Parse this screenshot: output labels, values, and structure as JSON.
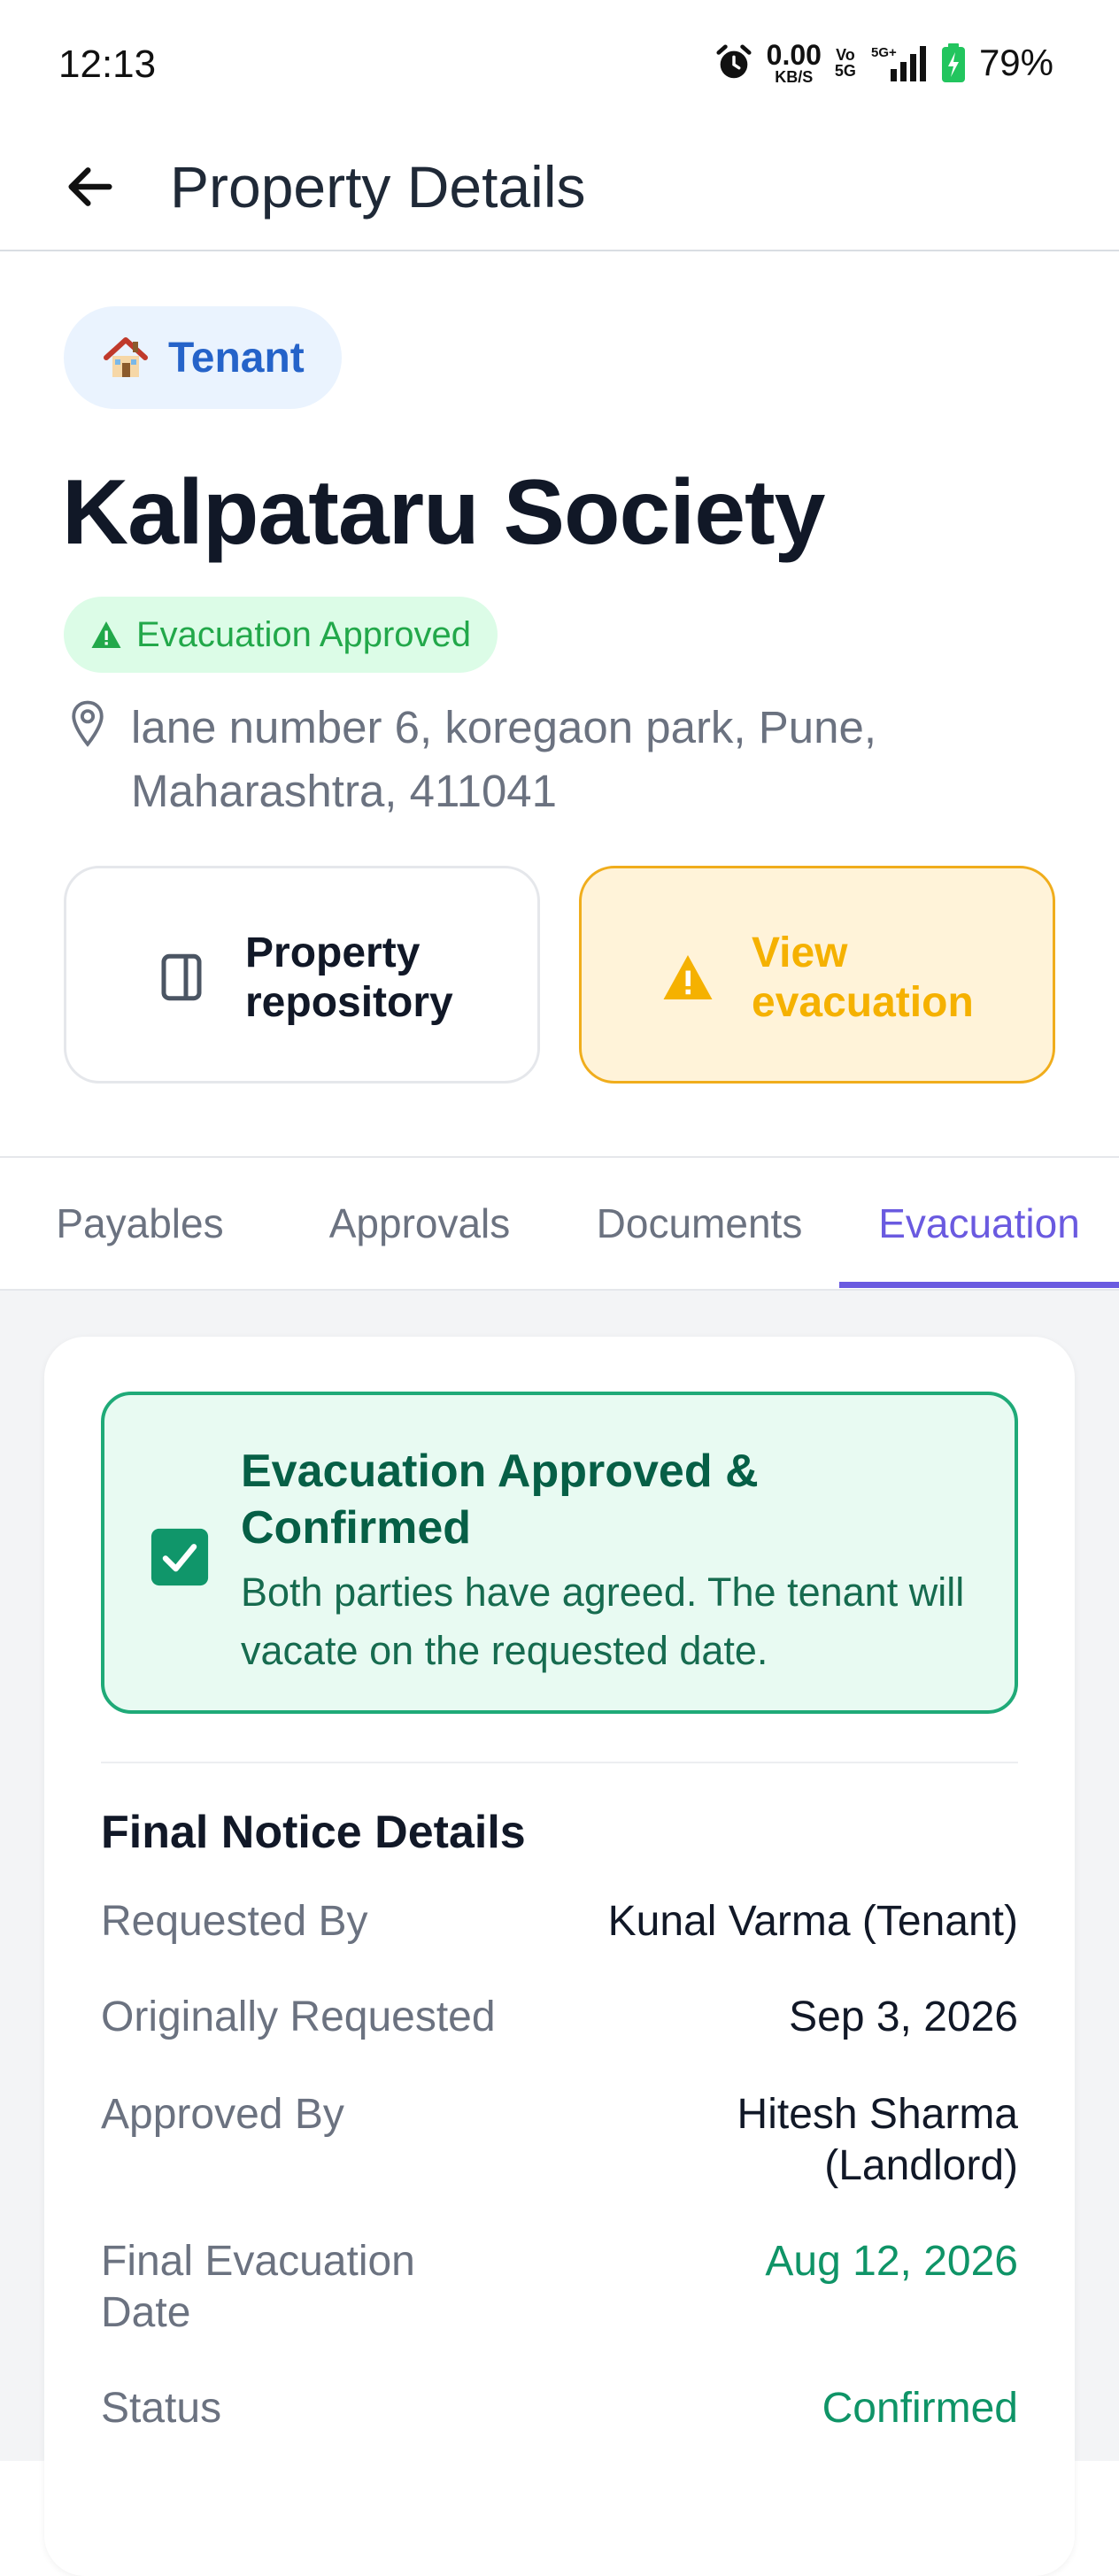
{
  "status_bar": {
    "time": "12:13",
    "net_speed_value": "0.00",
    "net_speed_unit": "KB/S",
    "volte_top": "Vo",
    "volte_bottom": "5G",
    "network_label": "5G+",
    "battery_percent": "79%",
    "icons": [
      "alarm-icon",
      "signal-icon",
      "battery-charging-icon"
    ]
  },
  "app_bar": {
    "title": "Property Details",
    "back_icon": "arrow-left-icon"
  },
  "property": {
    "role_icon": "house-icon",
    "role": "Tenant",
    "name": "Kalpataru Society",
    "status": "Evacuation Approved",
    "address_line1": "lane number 6, koregaon park, Pune,",
    "address_line2": "Maharashtra, 411041"
  },
  "actions": {
    "repository_line1": "Property",
    "repository_line2": "repository",
    "evacuation_line1": "View",
    "evacuation_line2": "evacuation"
  },
  "tabs": [
    {
      "label": "Payables",
      "active": false
    },
    {
      "label": "Approvals",
      "active": false
    },
    {
      "label": "Documents",
      "active": false
    },
    {
      "label": "Evacuation",
      "active": true
    }
  ],
  "evacuation": {
    "confirm_title_line1": "Evacuation Approved &",
    "confirm_title_line2": "Confirmed",
    "confirm_desc_line1": "Both parties have agreed. The tenant will",
    "confirm_desc_line2": "vacate on the requested date.",
    "notice_title": "Final Notice Details",
    "details": {
      "requested_by_label": "Requested By",
      "requested_by_value": "Kunal Varma (Tenant)",
      "originally_requested_label": "Originally Requested",
      "originally_requested_value": "Sep 3, 2026",
      "approved_by_label": "Approved By",
      "approved_by_value_line1": "Hitesh Sharma",
      "approved_by_value_line2": "(Landlord)",
      "final_date_label_line1": "Final Evacuation",
      "final_date_label_line2": "Date",
      "final_date_value": "Aug 12, 2026",
      "status_label": "Status",
      "status_value": "Confirmed"
    }
  },
  "colors": {
    "accent": "#6a5ae0",
    "role_blue": "#2563c9",
    "success_green": "#0f9467",
    "warning_amber": "#f5b100"
  }
}
